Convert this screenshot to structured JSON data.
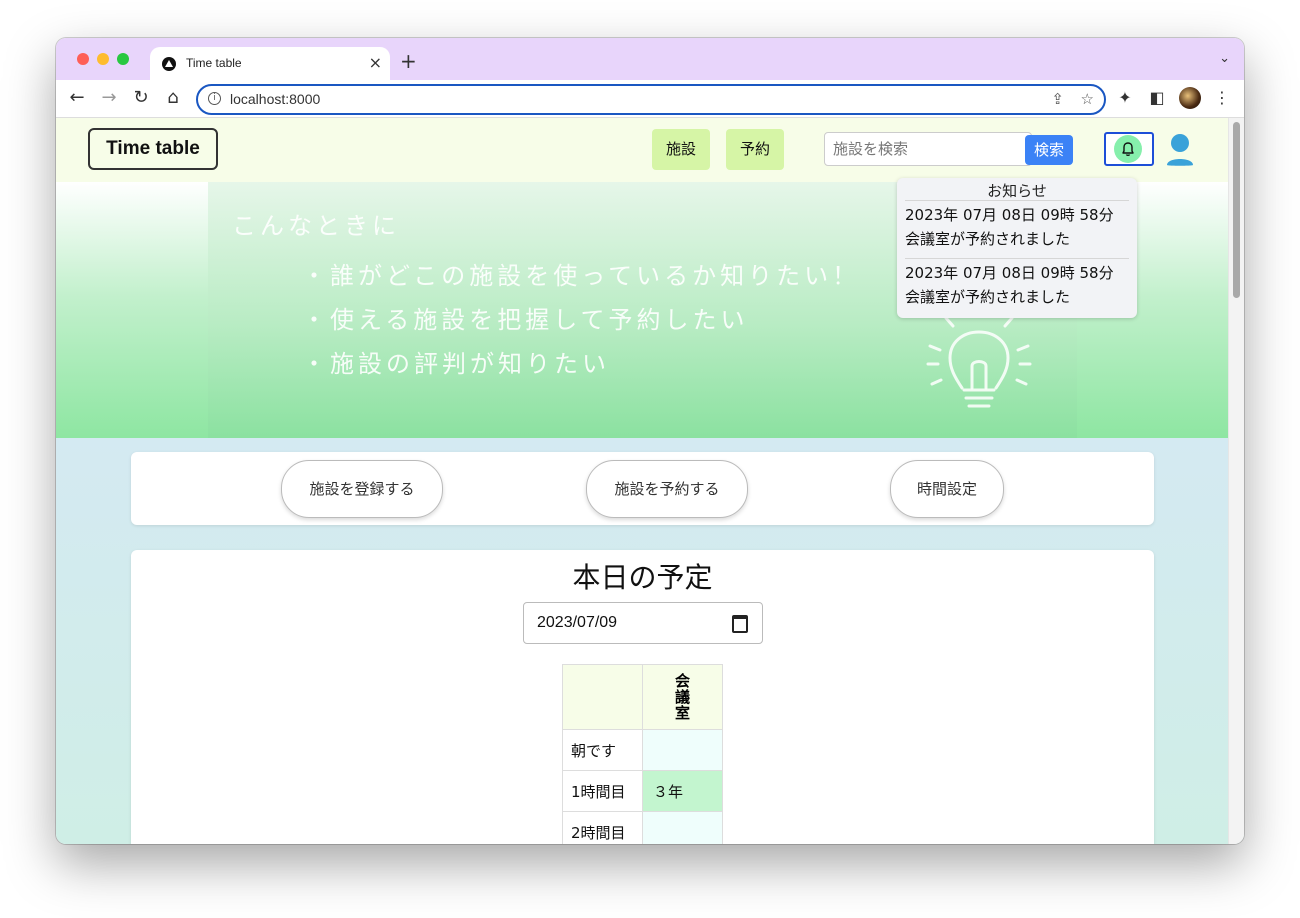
{
  "browser": {
    "tab_title": "Time table",
    "new_tab": "+",
    "tab_close": "×",
    "url": "localhost:8000"
  },
  "header": {
    "brand": "Time table",
    "nav": [
      "施設",
      "予約"
    ],
    "search_placeholder": "施設を検索",
    "search_button": "検索"
  },
  "hero": {
    "title": "こんなときに",
    "lines": [
      "・誰がどこの施設を使っているか知りたい！",
      "・使える施設を把握して予約したい",
      "・施設の評判が知りたい"
    ]
  },
  "notifications": {
    "title": "お知らせ",
    "items": [
      {
        "date": "2023年 07月 08日 09時 58分",
        "message": "会議室が予約されました"
      },
      {
        "date": "2023年 07月 08日 09時 58分",
        "message": "会議室が予約されました"
      }
    ]
  },
  "actions": [
    "施設を登録する",
    "施設を予約する",
    "時間設定"
  ],
  "schedule": {
    "title": "本日の予定",
    "date": "2023/07/09",
    "facility": "会議室",
    "rows": [
      {
        "period": "朝です",
        "value": ""
      },
      {
        "period": "1時間目",
        "value": "３年"
      },
      {
        "period": "2時間目",
        "value": ""
      }
    ]
  },
  "colors": {
    "header_bg": "#f7fde8",
    "nav_button": "#d6f5a6",
    "search_button": "#3b82f6",
    "booked_cell": "#c3f5cf"
  }
}
